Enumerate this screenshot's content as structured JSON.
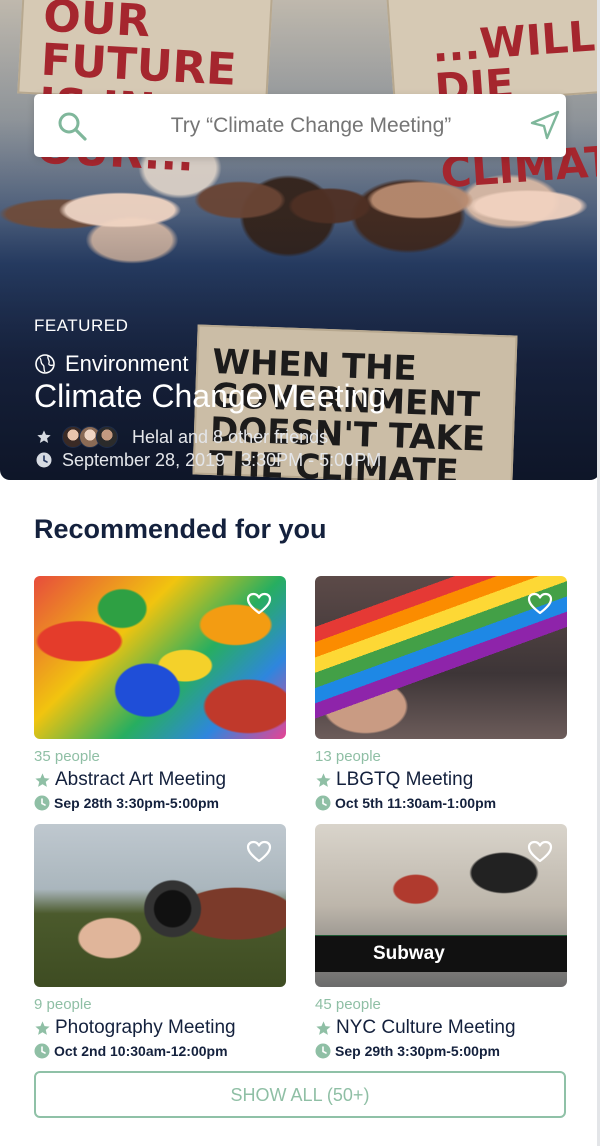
{
  "search": {
    "placeholder": "Try “Climate Change Meeting”"
  },
  "hero": {
    "signs": [
      "OUR FUTURE IS IN OUR...",
      "...WILL DIE OF CLIMATE",
      "WHEN THE GOVERNMENT DOESN'T TAKE THE CLIMATE SERIOUSLY"
    ],
    "label": "FEATURED",
    "category": "Environment",
    "title": "Climate Change Meeting",
    "friends": "Helal and 8 other friends",
    "date": "September 28, 2019",
    "time": "3:30PM - 5:00PM"
  },
  "recommended": {
    "heading": "Recommended for you",
    "cards": [
      {
        "people": "35 people",
        "title": "Abstract Art Meeting",
        "date": "Sep 28th 3:30pm-5:00pm"
      },
      {
        "people": "13 people",
        "title": "LBGTQ Meeting",
        "date": "Oct 5th 11:30am-1:00pm"
      },
      {
        "people": "9 people",
        "title": "Photography Meeting",
        "date": "Oct 2nd 10:30am-12:00pm"
      },
      {
        "people": "45 people",
        "title": "NYC Culture Meeting",
        "date": "Sep 29th 3:30pm-5:00pm",
        "sign": "Subway"
      }
    ],
    "show_all": "SHOW ALL (50+)"
  },
  "colors": {
    "accent": "#8fbfa5",
    "title": "#14213d",
    "placeholder": "#6b6b70"
  },
  "icons": [
    "search-icon",
    "location-arrow-icon",
    "globe-icon",
    "star-icon",
    "clock-icon",
    "heart-icon"
  ]
}
